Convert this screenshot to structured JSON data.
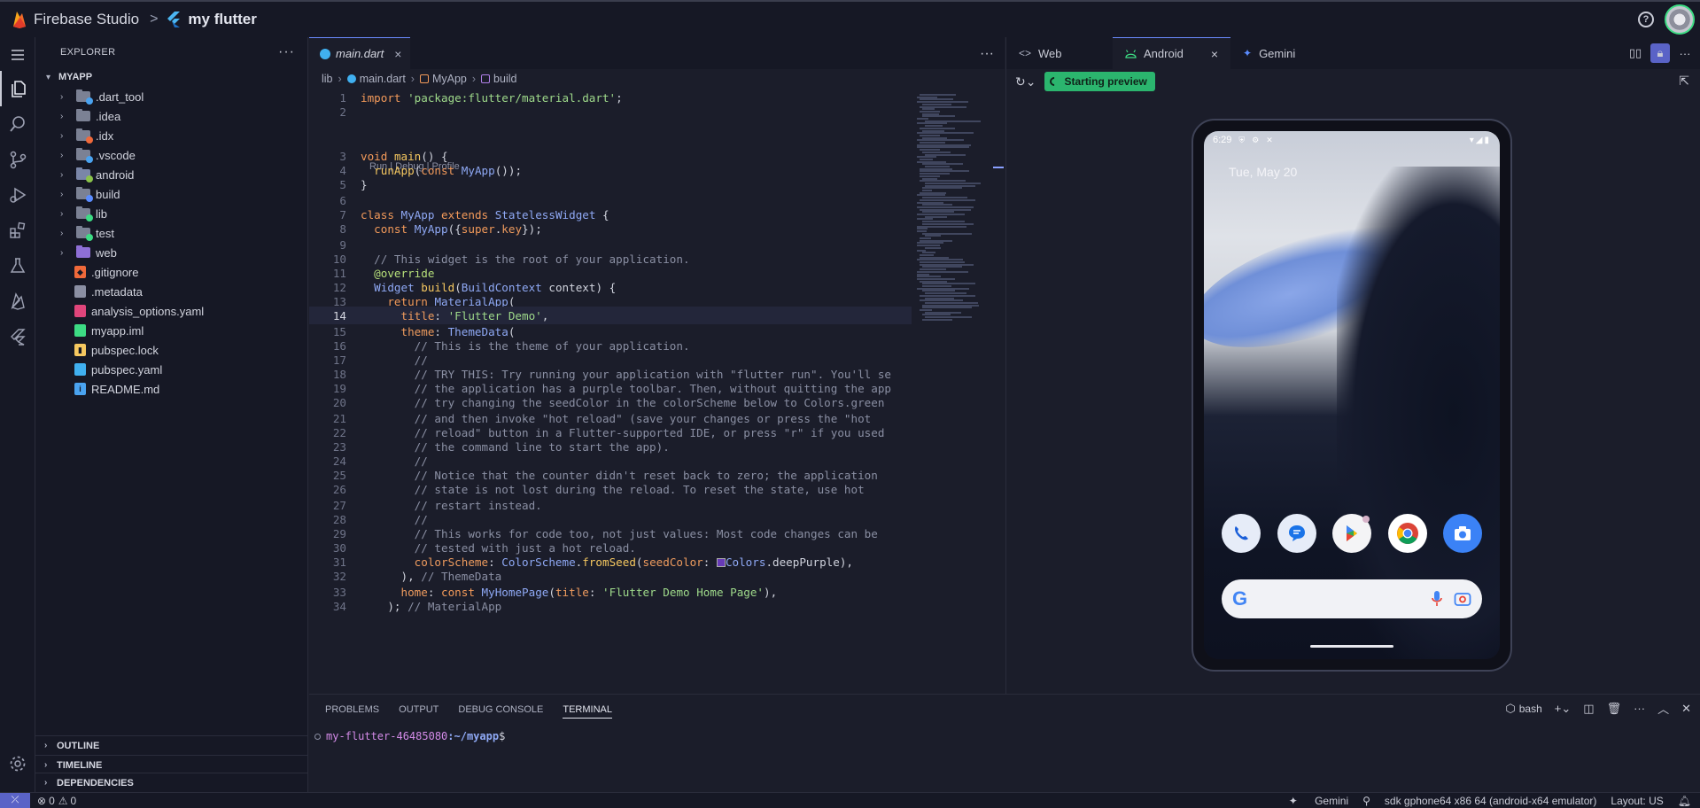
{
  "header": {
    "brand": "Firebase Studio",
    "separator": ">",
    "project": "my flutter",
    "help": "?"
  },
  "explorer": {
    "title": "EXPLORER",
    "more": "···",
    "root": "MYAPP",
    "items": [
      {
        "label": ".dart_tool",
        "kind": "folder",
        "color": "#7b8194",
        "badge": "#4aa3f0"
      },
      {
        "label": ".idea",
        "kind": "folder",
        "color": "#7b8194",
        "badge": ""
      },
      {
        "label": ".idx",
        "kind": "folder",
        "color": "#7b8194",
        "badge": "#f0693a"
      },
      {
        "label": ".vscode",
        "kind": "folder",
        "color": "#7b8194",
        "badge": "#4aa3f0"
      },
      {
        "label": "android",
        "kind": "folder",
        "color": "#7a86a8",
        "badge": "#8bc34a"
      },
      {
        "label": "build",
        "kind": "folder",
        "color": "#7b8194",
        "badge": "#5b8cff"
      },
      {
        "label": "lib",
        "kind": "folder",
        "color": "#7b8194",
        "badge": "#3ddc84"
      },
      {
        "label": "test",
        "kind": "folder",
        "color": "#7b8194",
        "badge": "#3ddc84"
      },
      {
        "label": "web",
        "kind": "folder",
        "color": "#8e6fd6",
        "badge": ""
      },
      {
        "label": ".gitignore",
        "kind": "file",
        "color": "#f0693a",
        "glyph": "◆"
      },
      {
        "label": ".metadata",
        "kind": "file",
        "color": "#8b8fa3",
        "glyph": ""
      },
      {
        "label": "analysis_options.yaml",
        "kind": "file",
        "color": "#e0457b",
        "glyph": ""
      },
      {
        "label": "myapp.iml",
        "kind": "file",
        "color": "#3ddc84",
        "glyph": ""
      },
      {
        "label": "pubspec.lock",
        "kind": "file",
        "color": "#f6c860",
        "glyph": "▮"
      },
      {
        "label": "pubspec.yaml",
        "kind": "file",
        "color": "#40b0f0",
        "glyph": ""
      },
      {
        "label": "README.md",
        "kind": "file",
        "color": "#4aa3f0",
        "glyph": "i"
      }
    ],
    "sections": [
      "OUTLINE",
      "TIMELINE",
      "DEPENDENCIES"
    ]
  },
  "editor": {
    "tab": "main.dart",
    "close": "×",
    "more": "···",
    "breadcrumb": [
      "lib",
      "main.dart",
      "MyApp",
      "build"
    ],
    "codelens": "Run | Debug | Profile",
    "current_line": 14
  },
  "preview": {
    "tabs": [
      {
        "label": "Web",
        "icon": "<>"
      },
      {
        "label": "Android",
        "icon": "android"
      },
      {
        "label": "Gemini",
        "icon": "✦"
      }
    ],
    "status": "Starting preview",
    "phone": {
      "time": "6:29",
      "date": "Tue, May 20"
    }
  },
  "panel": {
    "tabs": [
      "PROBLEMS",
      "OUTPUT",
      "DEBUG CONSOLE",
      "TERMINAL"
    ],
    "active": "TERMINAL",
    "shell": "bash",
    "prompt_host": "my-flutter-46485080",
    "prompt_path": ":~/myapp",
    "prompt_symbol": "$"
  },
  "statusbar": {
    "errors": "0",
    "warnings": "0",
    "gemini": "Gemini",
    "device": "sdk gphone64 x86 64 (android-x64 emulator)",
    "layout": "Layout: US"
  },
  "colors": {
    "accent": "#5a63c7",
    "success": "#2bb56e",
    "background": "#1b1d2a"
  }
}
